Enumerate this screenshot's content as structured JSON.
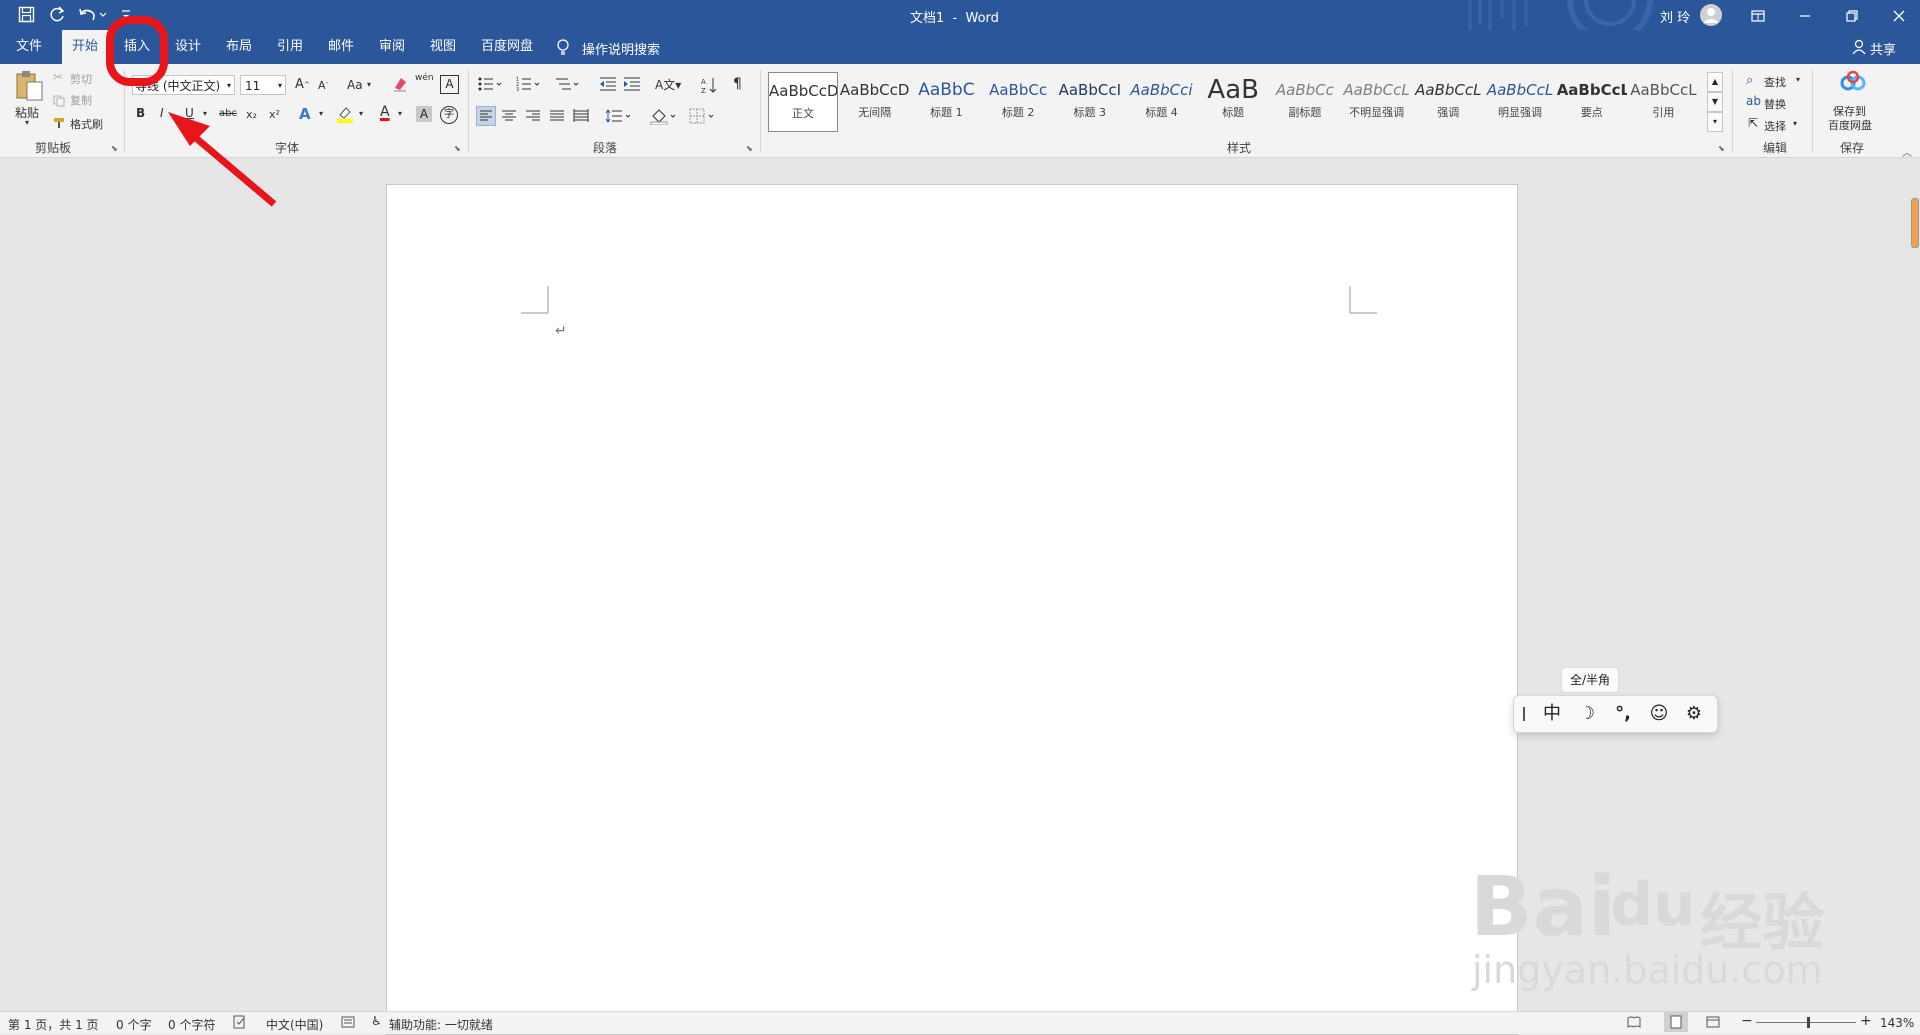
{
  "title_bar": {
    "doc_title": "文档1  -  Word",
    "user_name": "刘 玲",
    "icons": [
      "save-icon",
      "redo-icon",
      "undo-icon",
      "customize-icon",
      "avatar-icon",
      "ribbon-display-icon",
      "minimize-icon",
      "restore-icon",
      "close-icon"
    ]
  },
  "tabs": [
    "文件",
    "开始",
    "插入",
    "设计",
    "布局",
    "引用",
    "邮件",
    "审阅",
    "视图",
    "百度网盘"
  ],
  "active_tab": "开始",
  "tell_me": "操作说明搜索",
  "share": "共享",
  "clipboard": {
    "group": "剪贴板",
    "paste": "粘贴",
    "cut": "剪切",
    "copy": "复制",
    "format_painter": "格式刷"
  },
  "font": {
    "group": "字体",
    "font_name": "等线 (中文正文)",
    "font_size": "11",
    "case": "Aa",
    "bold": "B",
    "italic": "I",
    "underline": "U",
    "strike": "abc",
    "sub": "x₂",
    "sup": "x²",
    "font_color_glyph": "A",
    "wen": "wén",
    "char_border": "A",
    "phonetic": "字"
  },
  "paragraph": {
    "group": "段落"
  },
  "styles": {
    "group": "样式",
    "items": [
      {
        "sample": "AaBbCcD",
        "name": "正文",
        "color": "#333333"
      },
      {
        "sample": "AaBbCcD",
        "name": "无间隔",
        "color": "#333333"
      },
      {
        "sample": "AaBbC",
        "name": "标题 1",
        "color": "#2f5597"
      },
      {
        "sample": "AaBbCc",
        "name": "标题 2",
        "color": "#2f5597"
      },
      {
        "sample": "AaBbCcI",
        "name": "标题 3",
        "color": "#1f3864"
      },
      {
        "sample": "AaBbCci",
        "name": "标题 4",
        "color": "#2f5597"
      },
      {
        "sample": "AaB",
        "name": "标题",
        "color": "#333333"
      },
      {
        "sample": "AaBbCc",
        "name": "副标题",
        "color": "#7f7f7f"
      },
      {
        "sample": "AaBbCcL",
        "name": "不明显强调",
        "color": "#7f7f7f"
      },
      {
        "sample": "AaBbCcL",
        "name": "强调",
        "color": "#333333"
      },
      {
        "sample": "AaBbCcL",
        "name": "明显强调",
        "color": "#2f5597"
      },
      {
        "sample": "AaBbCcL",
        "name": "要点",
        "color": "#333333"
      },
      {
        "sample": "AaBbCcL",
        "name": "引用",
        "color": "#555555"
      }
    ]
  },
  "editing": {
    "group": "编辑",
    "find": "查找",
    "replace": "替换",
    "select": "选择"
  },
  "save_group": {
    "group": "保存",
    "label_line1": "保存到",
    "label_line2": "百度网盘"
  },
  "document": {
    "paragraph_mark": "↵"
  },
  "ime": {
    "tooltip": "全/半角",
    "mode": "中",
    "punct": "°,"
  },
  "status": {
    "page": "第 1 页，共 1 页",
    "words": "0 个字",
    "chars": "0 个字符",
    "lang": "中文(中国)",
    "accessibility": "辅助功能: 一切就绪",
    "zoom": "143%"
  },
  "watermark": {
    "brand": "Bai",
    "paw": "du",
    "jy": "经验",
    "url": "jingyan.baidu.com"
  },
  "colors": {
    "title_blue": "#2b579a",
    "annotation_red": "#e8161b"
  }
}
